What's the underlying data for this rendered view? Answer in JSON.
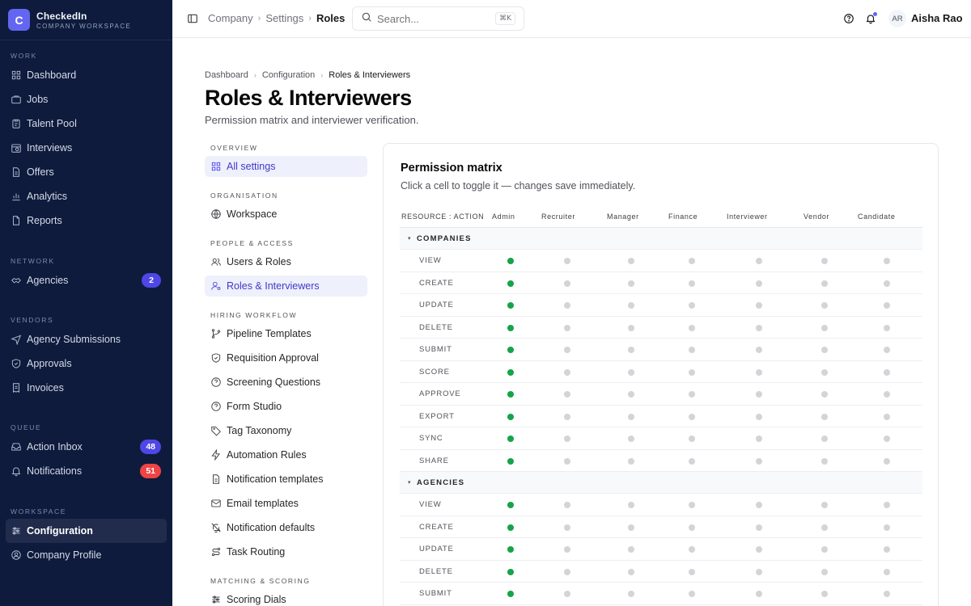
{
  "brand": {
    "logo_letter": "C",
    "name": "CheckedIn",
    "subtitle": "COMPANY WORKSPACE"
  },
  "sidebar": {
    "sections": [
      {
        "heading": "WORK",
        "items": [
          {
            "label": "Dashboard",
            "icon": "grid-icon"
          },
          {
            "label": "Jobs",
            "icon": "briefcase-icon"
          },
          {
            "label": "Talent Pool",
            "icon": "clipboard-icon"
          },
          {
            "label": "Interviews",
            "icon": "calendar-clock-icon"
          },
          {
            "label": "Offers",
            "icon": "file-text-icon"
          },
          {
            "label": "Analytics",
            "icon": "bar-chart-icon"
          },
          {
            "label": "Reports",
            "icon": "file-icon"
          }
        ]
      },
      {
        "heading": "NETWORK",
        "items": [
          {
            "label": "Agencies",
            "icon": "handshake-icon",
            "badge": "2"
          }
        ]
      },
      {
        "heading": "VENDORS",
        "items": [
          {
            "label": "Agency Submissions",
            "icon": "send-icon"
          },
          {
            "label": "Approvals",
            "icon": "shield-check-icon"
          },
          {
            "label": "Invoices",
            "icon": "receipt-icon"
          }
        ]
      },
      {
        "heading": "QUEUE",
        "items": [
          {
            "label": "Action Inbox",
            "icon": "inbox-icon",
            "badge": "48"
          },
          {
            "label": "Notifications",
            "icon": "bell-icon",
            "badge": "51"
          }
        ]
      },
      {
        "heading": "WORKSPACE",
        "items": [
          {
            "label": "Configuration",
            "icon": "sliders-icon",
            "active": true
          },
          {
            "label": "Company Profile",
            "icon": "user-circle-icon"
          }
        ]
      }
    ]
  },
  "topbar": {
    "breadcrumb": [
      "Company",
      "Settings",
      "Roles"
    ],
    "search_placeholder": "Search...",
    "search_shortcut": "⌘K",
    "user_initials": "AR",
    "user_name": "Aisha Rao"
  },
  "page": {
    "breadcrumb": [
      "Dashboard",
      "Configuration",
      "Roles & Interviewers"
    ],
    "title": "Roles & Interviewers",
    "subtitle": "Permission matrix and interviewer verification."
  },
  "settings_nav": [
    {
      "heading": "OVERVIEW",
      "items": [
        {
          "label": "All settings",
          "icon": "grid-icon",
          "active": true
        }
      ]
    },
    {
      "heading": "ORGANISATION",
      "items": [
        {
          "label": "Workspace",
          "icon": "globe-icon"
        }
      ]
    },
    {
      "heading": "PEOPLE & ACCESS",
      "items": [
        {
          "label": "Users & Roles",
          "icon": "users-icon"
        },
        {
          "label": "Roles & Interviewers",
          "icon": "user-cog-icon",
          "active": true
        }
      ]
    },
    {
      "heading": "HIRING WORKFLOW",
      "items": [
        {
          "label": "Pipeline Templates",
          "icon": "git-branch-icon"
        },
        {
          "label": "Requisition Approval",
          "icon": "shield-check-icon"
        },
        {
          "label": "Screening Questions",
          "icon": "help-circle-icon"
        },
        {
          "label": "Form Studio",
          "icon": "help-circle-icon"
        },
        {
          "label": "Tag Taxonomy",
          "icon": "tag-icon"
        },
        {
          "label": "Automation Rules",
          "icon": "zap-icon"
        },
        {
          "label": "Notification templates",
          "icon": "file-text-icon"
        },
        {
          "label": "Email templates",
          "icon": "mail-icon"
        },
        {
          "label": "Notification defaults",
          "icon": "bell-off-icon"
        },
        {
          "label": "Task Routing",
          "icon": "route-icon"
        }
      ]
    },
    {
      "heading": "MATCHING & SCORING",
      "items": [
        {
          "label": "Scoring Dials",
          "icon": "sliders-icon"
        }
      ]
    }
  ],
  "matrix": {
    "title": "Permission matrix",
    "subtitle": "Click a cell to toggle it — changes save immediately.",
    "header_label": "RESOURCE : ACTION",
    "roles": [
      "Admin",
      "Recruiter",
      "Manager",
      "Finance",
      "Interviewer",
      "Vendor",
      "Candidate"
    ],
    "groups": [
      {
        "name": "COMPANIES",
        "actions": [
          {
            "action": "VIEW",
            "grants": [
              true,
              false,
              false,
              false,
              false,
              false,
              false
            ]
          },
          {
            "action": "CREATE",
            "grants": [
              true,
              false,
              false,
              false,
              false,
              false,
              false
            ]
          },
          {
            "action": "UPDATE",
            "grants": [
              true,
              false,
              false,
              false,
              false,
              false,
              false
            ]
          },
          {
            "action": "DELETE",
            "grants": [
              true,
              false,
              false,
              false,
              false,
              false,
              false
            ]
          },
          {
            "action": "SUBMIT",
            "grants": [
              true,
              false,
              false,
              false,
              false,
              false,
              false
            ]
          },
          {
            "action": "SCORE",
            "grants": [
              true,
              false,
              false,
              false,
              false,
              false,
              false
            ]
          },
          {
            "action": "APPROVE",
            "grants": [
              true,
              false,
              false,
              false,
              false,
              false,
              false
            ]
          },
          {
            "action": "EXPORT",
            "grants": [
              true,
              false,
              false,
              false,
              false,
              false,
              false
            ]
          },
          {
            "action": "SYNC",
            "grants": [
              true,
              false,
              false,
              false,
              false,
              false,
              false
            ]
          },
          {
            "action": "SHARE",
            "grants": [
              true,
              false,
              false,
              false,
              false,
              false,
              false
            ]
          }
        ]
      },
      {
        "name": "AGENCIES",
        "actions": [
          {
            "action": "VIEW",
            "grants": [
              true,
              false,
              false,
              false,
              false,
              false,
              false
            ]
          },
          {
            "action": "CREATE",
            "grants": [
              true,
              false,
              false,
              false,
              false,
              false,
              false
            ]
          },
          {
            "action": "UPDATE",
            "grants": [
              true,
              false,
              false,
              false,
              false,
              false,
              false
            ]
          },
          {
            "action": "DELETE",
            "grants": [
              true,
              false,
              false,
              false,
              false,
              false,
              false
            ]
          },
          {
            "action": "SUBMIT",
            "grants": [
              true,
              false,
              false,
              false,
              false,
              false,
              false
            ]
          }
        ]
      }
    ]
  },
  "colors": {
    "sidebar_bg": "#0f1b3d",
    "accent": "#6366f1",
    "granted": "#16a34a",
    "denied": "#d4d4d8",
    "badge_blue": "#4f46e5",
    "badge_red": "#ef4444"
  }
}
